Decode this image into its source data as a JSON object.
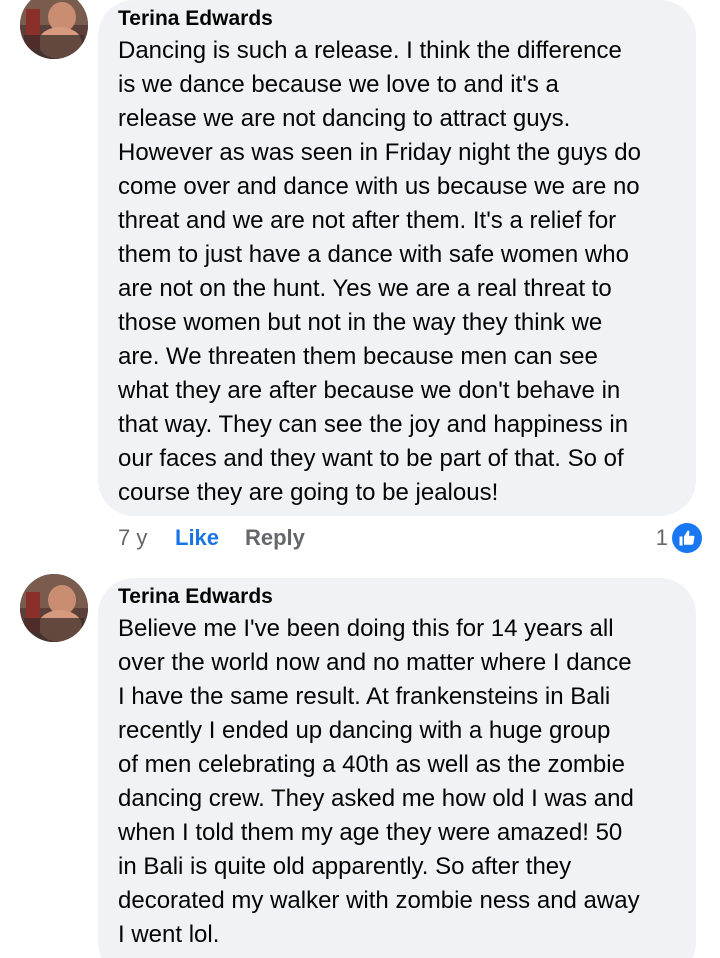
{
  "comments": [
    {
      "author": "Terina Edwards",
      "lines": [
        "Dancing is such a release. I think the difference",
        "is we dance because we love to and it's a",
        "release we are not dancing to attract guys.",
        "However as was seen in Friday night the guys do",
        "come over and dance with us because we are no",
        "threat and we are not after them. It's a relief for",
        "them to just have a dance with safe women who",
        "are not on the hunt. Yes we are a real threat to",
        "those women but not in the way they think we",
        "are. We threaten them because men can see",
        "what they are after because we don't behave in",
        "that way. They can see the joy and happiness in",
        "our faces and they want to be part of that. So of",
        "course they are going to be jealous!"
      ],
      "time": "7 y",
      "like_label": "Like",
      "reply_label": "Reply",
      "reaction_count": "1",
      "reaction_icon": "like-reaction-icon"
    },
    {
      "author": "Terina Edwards",
      "lines": [
        "Believe me I've been doing this for 14 years all",
        "over the world now and no matter where I dance",
        "I have the same result. At frankensteins in Bali",
        "recently I ended up dancing with a huge group",
        "of men celebrating a 40th as well as the zombie",
        "dancing crew. They asked me how old I was and",
        "when I told them my age they were amazed! 50",
        "in Bali is quite old apparently. So after they",
        "decorated my walker with zombie ness and away",
        "I went lol."
      ]
    }
  ],
  "colors": {
    "bubble": "#f0f2f5",
    "link_blue": "#1b74e4",
    "muted": "#65676b",
    "reaction_blue": "#1877f2"
  }
}
